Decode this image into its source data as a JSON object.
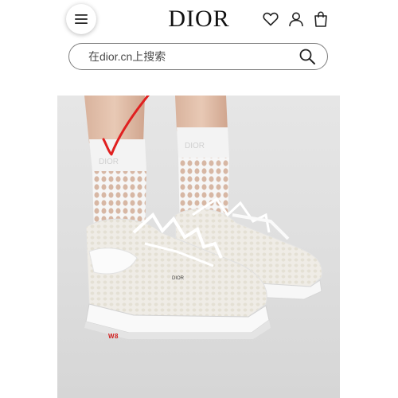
{
  "header": {
    "brand": "DIOR",
    "icons": {
      "menu": "menu-icon",
      "wishlist": "heart-icon",
      "account": "user-icon",
      "bag": "shopping-bag-icon"
    }
  },
  "search": {
    "placeholder": "在dior.cn上搜索",
    "icon": "search-icon"
  },
  "product": {
    "watermark": "W8",
    "colors": {
      "background": "#e2e2e2",
      "annotation": "#e02020",
      "watermark": "#d11a1a"
    }
  }
}
